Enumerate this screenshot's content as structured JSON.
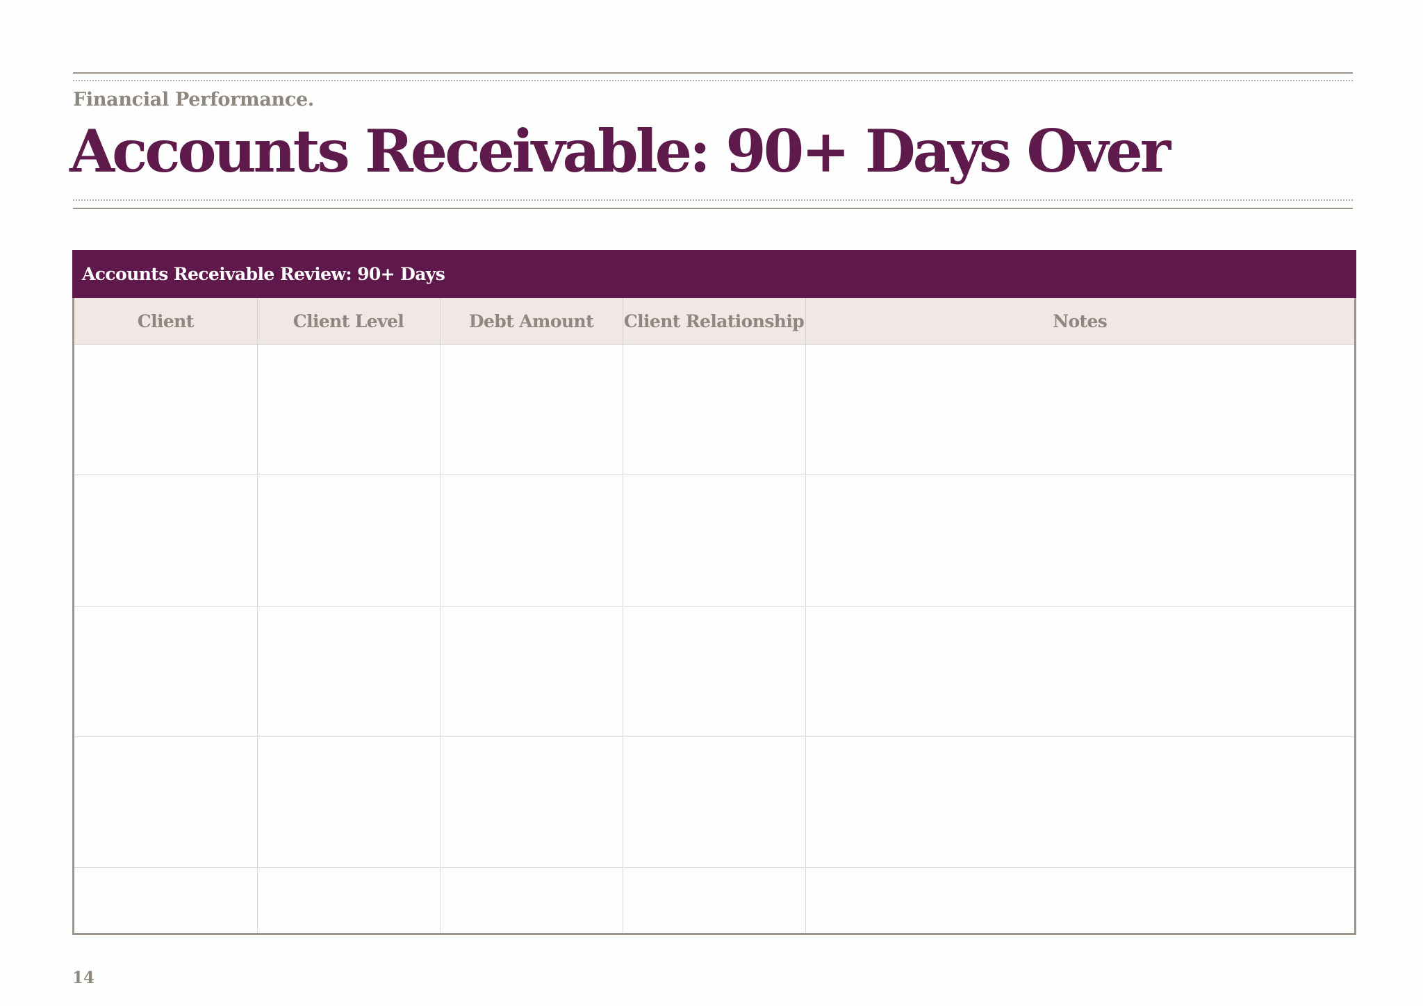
{
  "header": {
    "eyebrow": "Financial Performance.",
    "title": "Accounts Receivable: 90+ Days Over"
  },
  "table": {
    "banner": "Accounts Receivable Review: 90+ Days",
    "columns": [
      "Client",
      "Client Level",
      "Debt Amount",
      "Client Relationship",
      "Notes"
    ],
    "rows": [
      [
        "",
        "",
        "",
        "",
        ""
      ],
      [
        "",
        "",
        "",
        "",
        ""
      ],
      [
        "",
        "",
        "",
        "",
        ""
      ],
      [
        "",
        "",
        "",
        "",
        ""
      ],
      [
        "",
        "",
        "",
        "",
        ""
      ]
    ]
  },
  "footer": {
    "page_number": "14"
  },
  "colors": {
    "accent": "#5e184b",
    "muted_text": "#8e877f",
    "header_fill": "#efe8e4"
  }
}
